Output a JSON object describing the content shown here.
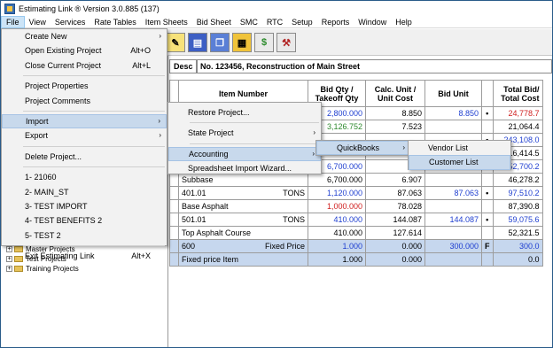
{
  "window": {
    "title": "Estimating Link ® Version  3.0.885 (137)"
  },
  "menubar": {
    "items": [
      "File",
      "View",
      "Services",
      "Rate Tables",
      "Item Sheets",
      "Bid Sheet",
      "SMC",
      "RTC",
      "Setup",
      "Reports",
      "Window",
      "Help"
    ]
  },
  "toolbar": {
    "icons": [
      "edit-icon",
      "book-icon",
      "pages-icon",
      "folders-icon",
      "dollar-icon",
      "tools-icon"
    ]
  },
  "tree": {
    "items": [
      "Master Projects",
      "Test Projects",
      "Training Projects"
    ]
  },
  "description": {
    "label": "Desc",
    "value": "No. 123456, Reconstruction of Main Street"
  },
  "grid": {
    "headers": {
      "item_number": "Item Number",
      "bid_qty_1": "Bid Qty /",
      "bid_qty_2": "Takeoff Qty",
      "calc_1": "Calc. Unit /",
      "calc_2": "Unit Cost",
      "bid_unit": "Bid Unit",
      "total_1": "Total Bid/",
      "total_2": "Total Cost"
    },
    "rows": [
      {
        "item": "",
        "unit": "",
        "qty": "2,800.000",
        "calc": "8.850",
        "bid": "8.850",
        "dot": "•",
        "total": "24,778.7"
      },
      {
        "item": "",
        "unit": "",
        "qty": "3,126.752",
        "calc": "7.523",
        "bid": "",
        "dot": "",
        "total": "21,064.4"
      },
      {
        "item": "",
        "unit": "",
        "qty": "",
        "calc": "",
        "bid": "",
        "dot": "•",
        "total": "243,108.0"
      },
      {
        "item": "",
        "unit": "",
        "qty": "",
        "calc": "",
        "bid": "",
        "dot": "",
        "total": "216,414.5"
      },
      {
        "item": "",
        "unit": "",
        "qty": "6,700.000",
        "calc": "",
        "bid": "",
        "dot": "",
        "total": "52,700.2"
      },
      {
        "item": "Subbase",
        "unit": "",
        "qty": "6,700.000",
        "calc": "6.907",
        "bid": "",
        "dot": "",
        "total": "46,278.2"
      },
      {
        "item": "401.01",
        "unit": "TONS",
        "qty": "1,120.000",
        "calc": "87.063",
        "bid": "87.063",
        "dot": "•",
        "total": "97,510.2"
      },
      {
        "item": "Base Asphalt",
        "unit": "",
        "qty": "1,000.000",
        "calc": "78.028",
        "bid": "",
        "dot": "",
        "total": "87,390.8"
      },
      {
        "item": "501.01",
        "unit": "TONS",
        "qty": "410.000",
        "calc": "144.087",
        "bid": "144.087",
        "dot": "•",
        "total": "59,075.6"
      },
      {
        "item": "Top Asphalt Course",
        "unit": "",
        "qty": "410.000",
        "calc": "127.614",
        "bid": "",
        "dot": "",
        "total": "52,321.5"
      },
      {
        "item": "600",
        "unit": "Fixed Price",
        "qty": "1.000",
        "calc": "0.000",
        "bid": "300.000",
        "dot": "F",
        "total": "300.0"
      },
      {
        "item": "Fixed price Item",
        "unit": "",
        "qty": "1.000",
        "calc": "0.000",
        "bid": "",
        "dot": "",
        "total": "0.0"
      }
    ]
  },
  "file_menu": {
    "items": [
      {
        "label": "Create New",
        "shortcut": "",
        "arrow": "›"
      },
      {
        "label": "Open Existing Project",
        "shortcut": "Alt+O",
        "arrow": ""
      },
      {
        "label": "Close Current Project",
        "shortcut": "Alt+L",
        "arrow": ""
      },
      {
        "label": "Project Properties",
        "shortcut": "",
        "arrow": ""
      },
      {
        "label": "Project Comments",
        "shortcut": "",
        "arrow": ""
      },
      {
        "label": "Import",
        "shortcut": "",
        "arrow": "›"
      },
      {
        "label": "Export",
        "shortcut": "",
        "arrow": "›"
      },
      {
        "label": "Delete Project...",
        "shortcut": "",
        "arrow": ""
      },
      {
        "label": "1- 21060",
        "shortcut": "",
        "arrow": ""
      },
      {
        "label": "2- MAIN_ST",
        "shortcut": "",
        "arrow": ""
      },
      {
        "label": "3- TEST IMPORT",
        "shortcut": "",
        "arrow": ""
      },
      {
        "label": "4- TEST BENEFITS 2",
        "shortcut": "",
        "arrow": ""
      },
      {
        "label": "5- TEST 2",
        "shortcut": "",
        "arrow": ""
      },
      {
        "label": "Exit Estimating Link",
        "shortcut": "Alt+X",
        "arrow": ""
      }
    ]
  },
  "import_menu": {
    "items": [
      {
        "label": "Restore Project...",
        "arrow": ""
      },
      {
        "label": "State Project",
        "arrow": "›"
      },
      {
        "label": "Accounting",
        "arrow": "›"
      },
      {
        "label": "Spreadsheet Import Wizard...",
        "arrow": ""
      }
    ]
  },
  "accounting_menu": {
    "items": [
      {
        "label": "QuickBooks",
        "arrow": "›"
      }
    ]
  },
  "quickbooks_menu": {
    "items": [
      {
        "label": "Vendor List"
      },
      {
        "label": "Customer List"
      }
    ]
  }
}
